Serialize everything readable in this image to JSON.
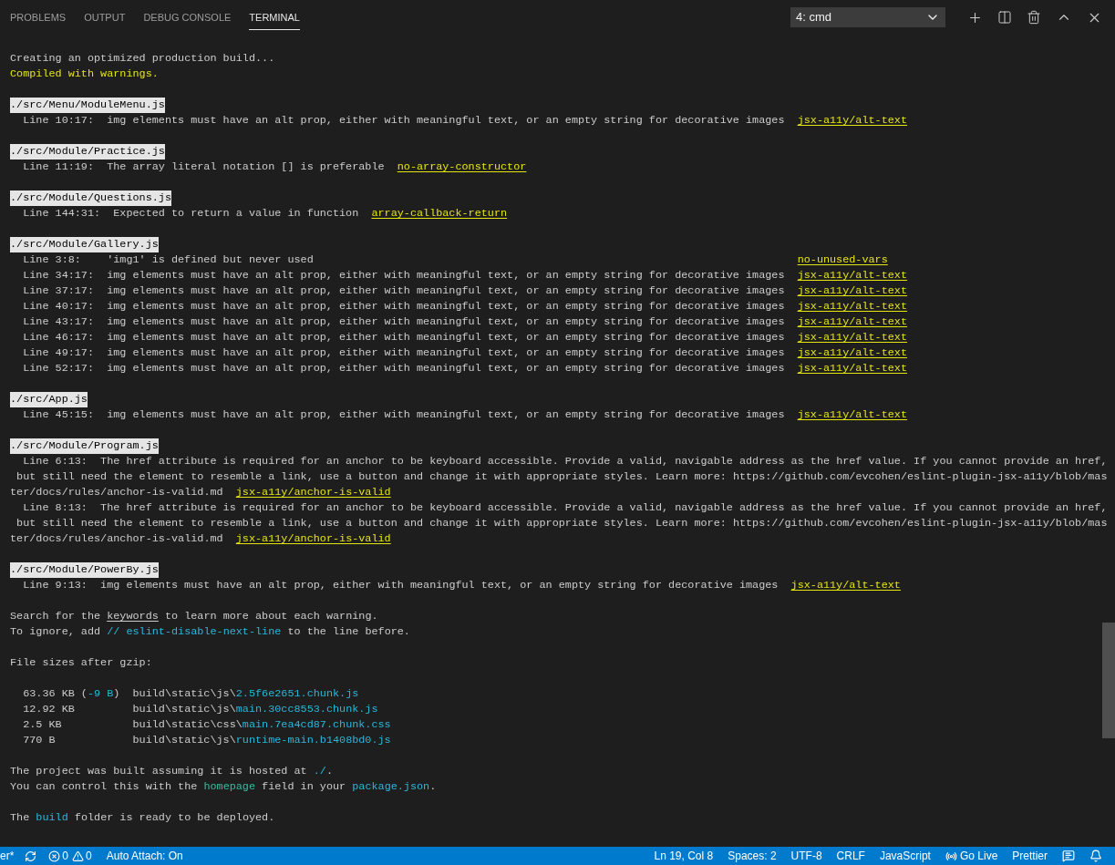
{
  "panel_tabs": [
    {
      "label": "PROBLEMS",
      "selected": false
    },
    {
      "label": "OUTPUT",
      "selected": false
    },
    {
      "label": "DEBUG CONSOLE",
      "selected": false
    },
    {
      "label": "TERMINAL",
      "selected": true
    }
  ],
  "terminal_select": {
    "value": "4: cmd"
  },
  "terminal": [
    {
      "kind": "blank"
    },
    {
      "kind": "line",
      "segments": [
        {
          "text": "Creating an optimized production build..."
        }
      ]
    },
    {
      "kind": "line",
      "segments": [
        {
          "text": "Compiled with warnings.",
          "kind": "yellow"
        }
      ]
    },
    {
      "kind": "blank"
    },
    {
      "kind": "file",
      "text": "./src/Menu/ModuleMenu.js"
    },
    {
      "kind": "warnings",
      "items": [
        {
          "location": "Line 10:17:",
          "message": [
            "img elements must have an alt prop, either with meaningful text, or an empty string for decorative images"
          ],
          "rule": "jsx-a11y/alt-text"
        }
      ]
    },
    {
      "kind": "blank"
    },
    {
      "kind": "file",
      "text": "./src/Module/Practice.js"
    },
    {
      "kind": "warnings",
      "items": [
        {
          "location": "Line 11:19:",
          "message": [
            "The array literal notation [] is preferable"
          ],
          "rule": "no-array-constructor"
        }
      ]
    },
    {
      "kind": "blank"
    },
    {
      "kind": "file",
      "text": "./src/Module/Questions.js"
    },
    {
      "kind": "warnings",
      "items": [
        {
          "location": "Line 144:31:",
          "message": [
            "Expected to return a value in function"
          ],
          "rule": "array-callback-return"
        }
      ]
    },
    {
      "kind": "blank"
    },
    {
      "kind": "file",
      "text": "./src/Module/Gallery.js"
    },
    {
      "kind": "warnings",
      "items": [
        {
          "location": "Line 3:8:",
          "message": [
            "'img1' is defined but never used"
          ],
          "rule": "no-unused-vars"
        },
        {
          "location": "Line 34:17:",
          "message": [
            "img elements must have an alt prop, either with meaningful text, or an empty string for decorative images"
          ],
          "rule": "jsx-a11y/alt-text"
        },
        {
          "location": "Line 37:17:",
          "message": [
            "img elements must have an alt prop, either with meaningful text, or an empty string for decorative images"
          ],
          "rule": "jsx-a11y/alt-text"
        },
        {
          "location": "Line 40:17:",
          "message": [
            "img elements must have an alt prop, either with meaningful text, or an empty string for decorative images"
          ],
          "rule": "jsx-a11y/alt-text"
        },
        {
          "location": "Line 43:17:",
          "message": [
            "img elements must have an alt prop, either with meaningful text, or an empty string for decorative images"
          ],
          "rule": "jsx-a11y/alt-text"
        },
        {
          "location": "Line 46:17:",
          "message": [
            "img elements must have an alt prop, either with meaningful text, or an empty string for decorative images"
          ],
          "rule": "jsx-a11y/alt-text"
        },
        {
          "location": "Line 49:17:",
          "message": [
            "img elements must have an alt prop, either with meaningful text, or an empty string for decorative images"
          ],
          "rule": "jsx-a11y/alt-text"
        },
        {
          "location": "Line 52:17:",
          "message": [
            "img elements must have an alt prop, either with meaningful text, or an empty string for decorative images"
          ],
          "rule": "jsx-a11y/alt-text"
        }
      ]
    },
    {
      "kind": "blank"
    },
    {
      "kind": "file",
      "text": "./src/App.js"
    },
    {
      "kind": "warnings",
      "items": [
        {
          "location": "Line 45:15:",
          "message": [
            "img elements must have an alt prop, either with meaningful text, or an empty string for decorative images"
          ],
          "rule": "jsx-a11y/alt-text"
        }
      ]
    },
    {
      "kind": "blank"
    },
    {
      "kind": "file",
      "text": "./src/Module/Program.js"
    },
    {
      "kind": "warnings",
      "items": [
        {
          "location": "Line 6:13:",
          "message": [
            "The href attribute is required for an anchor to be keyboard accessible. Provide a valid, navigable address as the href value. If you cannot provide an href,",
            " but still need the element to resemble a link, use a button and change it with appropriate styles. Learn more: https://github.com/evcohen/eslint-plugin-jsx-a11y/blob/mas",
            "ter/docs/rules/anchor-is-valid.md"
          ],
          "rule": "jsx-a11y/anchor-is-valid"
        },
        {
          "location": "Line 8:13:",
          "message": [
            "The href attribute is required for an anchor to be keyboard accessible. Provide a valid, navigable address as the href value. If you cannot provide an href,",
            " but still need the element to resemble a link, use a button and change it with appropriate styles. Learn more: https://github.com/evcohen/eslint-plugin-jsx-a11y/blob/mas",
            "ter/docs/rules/anchor-is-valid.md"
          ],
          "rule": "jsx-a11y/anchor-is-valid"
        }
      ]
    },
    {
      "kind": "blank"
    },
    {
      "kind": "file",
      "text": "./src/Module/PowerBy.js"
    },
    {
      "kind": "warnings",
      "items": [
        {
          "location": "Line 9:13:",
          "message": [
            "img elements must have an alt prop, either with meaningful text, or an empty string for decorative images"
          ],
          "rule": "jsx-a11y/alt-text"
        }
      ]
    },
    {
      "kind": "blank"
    },
    {
      "kind": "line",
      "segments": [
        {
          "text": "Search for the "
        },
        {
          "text": "keywords",
          "kind": "keyword"
        },
        {
          "text": " to learn more about each warning."
        }
      ]
    },
    {
      "kind": "line",
      "segments": [
        {
          "text": "To ignore, add "
        },
        {
          "text": "// eslint-disable-next-line",
          "kind": "cyan"
        },
        {
          "text": " to the line before."
        }
      ]
    },
    {
      "kind": "blank"
    },
    {
      "kind": "line",
      "segments": [
        {
          "text": "File sizes after gzip:"
        }
      ]
    },
    {
      "kind": "blank"
    },
    {
      "kind": "sizes",
      "items": [
        {
          "size": [
            {
              "text": "63.36 KB ("
            },
            {
              "text": "-9 B",
              "kind": "cyan"
            },
            {
              "text": ")"
            }
          ],
          "dir": "build\\static\\js\\",
          "file": "2.5f6e2651.chunk.js"
        },
        {
          "size": [
            {
              "text": "12.92 KB"
            }
          ],
          "dir": "build\\static\\js\\",
          "file": "main.30cc8553.chunk.js"
        },
        {
          "size": [
            {
              "text": "2.5 KB"
            }
          ],
          "dir": "build\\static\\css\\",
          "file": "main.7ea4cd87.chunk.css"
        },
        {
          "size": [
            {
              "text": "770 B"
            }
          ],
          "dir": "build\\static\\js\\",
          "file": "runtime-main.b1408bd0.js"
        }
      ]
    },
    {
      "kind": "blank"
    },
    {
      "kind": "line",
      "segments": [
        {
          "text": "The project was built assuming it is hosted at "
        },
        {
          "text": "./",
          "kind": "cyan"
        },
        {
          "text": "."
        }
      ]
    },
    {
      "kind": "line",
      "segments": [
        {
          "text": "You can control this with the "
        },
        {
          "text": "homepage",
          "kind": "green"
        },
        {
          "text": " field in your "
        },
        {
          "text": "package.json",
          "kind": "cyan"
        },
        {
          "text": "."
        }
      ]
    },
    {
      "kind": "blank"
    },
    {
      "kind": "line",
      "segments": [
        {
          "text": "The "
        },
        {
          "text": "build",
          "kind": "cyan"
        },
        {
          "text": " folder is ready to be deployed."
        }
      ]
    }
  ],
  "status_bar": {
    "branch": "er*",
    "errors": "0",
    "warnings": "0",
    "auto_attach": "Auto Attach: On",
    "items": [
      "Ln 19, Col 8",
      "Spaces: 2",
      "UTF-8",
      "CRLF",
      "JavaScript"
    ],
    "go_live": "Go Live",
    "formatter": "Prettier"
  }
}
